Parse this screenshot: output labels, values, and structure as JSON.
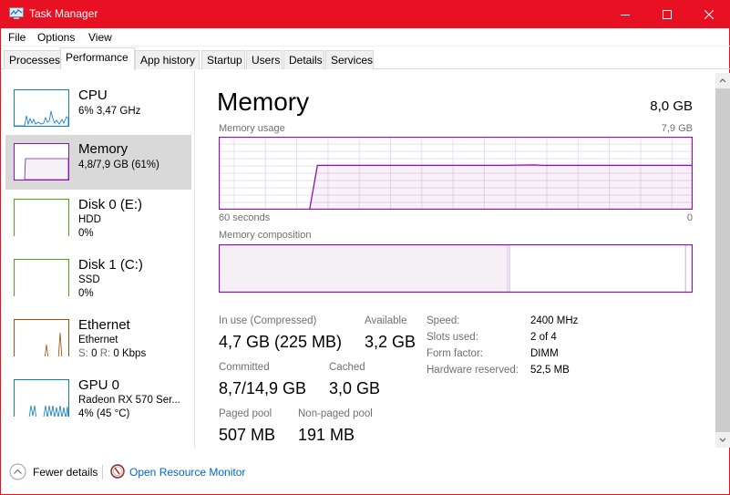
{
  "window": {
    "title": "Task Manager",
    "controls": {
      "minimize": "minimize",
      "maximize": "maximize",
      "close": "close"
    }
  },
  "menu": [
    "File",
    "Options",
    "View"
  ],
  "tabs": [
    {
      "label": "Processes",
      "active": false
    },
    {
      "label": "Performance",
      "active": true
    },
    {
      "label": "App history",
      "active": false
    },
    {
      "label": "Startup",
      "active": false
    },
    {
      "label": "Users",
      "active": false
    },
    {
      "label": "Details",
      "active": false
    },
    {
      "label": "Services",
      "active": false
    }
  ],
  "sidebar": {
    "items": [
      {
        "name": "CPU",
        "line1": "6%  3,47 GHz",
        "line2": "",
        "color": "#117dbb",
        "fill": "#f1f6fa",
        "selected": false
      },
      {
        "name": "Memory",
        "line1": "4,8/7,9 GB (61%)",
        "line2": "",
        "color": "#8b12ae",
        "fill": "#f4f2f4",
        "selected": true
      },
      {
        "name": "Disk 0 (E:)",
        "line1": "HDD",
        "line2": "0%",
        "color": "#4da60c",
        "fill": "#eff7ea",
        "selected": false
      },
      {
        "name": "Disk 1 (C:)",
        "line1": "SSD",
        "line2": "0%",
        "color": "#4da60c",
        "fill": "#eff7ea",
        "selected": false
      },
      {
        "name": "Ethernet",
        "line1": "Ethernet",
        "line2_s_label": "S:",
        "line2_s_val": "0",
        "line2_r_label": "R:",
        "line2_r_val": "0 Kbps",
        "color": "#a74f01",
        "fill": "#fcf3eb",
        "selected": false
      },
      {
        "name": "GPU 0",
        "line1": "Radeon RX 570 Ser...",
        "line2": "4%  (45 °C)",
        "color": "#117dbb",
        "fill": "#f1f6fa",
        "selected": false
      }
    ]
  },
  "main": {
    "title": "Memory",
    "total": "8,0 GB",
    "usage_graph": {
      "label": "Memory usage",
      "max_label": "7,9 GB",
      "left_axis": "60 seconds",
      "right_axis": "0"
    },
    "composition": {
      "label": "Memory composition",
      "in_use_fraction": 0.61,
      "modified_fraction": 0.005,
      "standby_fraction": 0.37,
      "free_fraction": 0.015
    },
    "stats": {
      "in_use_label": "In use (Compressed)",
      "in_use_value": "4,7 GB (225 MB)",
      "available_label": "Available",
      "available_value": "3,2 GB",
      "committed_label": "Committed",
      "committed_value": "8,7/14,9 GB",
      "cached_label": "Cached",
      "cached_value": "3,0 GB",
      "paged_label": "Paged pool",
      "paged_value": "507 MB",
      "nonpaged_label": "Non-paged pool",
      "nonpaged_value": "191 MB"
    },
    "details": [
      {
        "label": "Speed:",
        "value": "2400 MHz"
      },
      {
        "label": "Slots used:",
        "value": "2 of 4"
      },
      {
        "label": "Form factor:",
        "value": "DIMM"
      },
      {
        "label": "Hardware reserved:",
        "value": "52,5 MB"
      }
    ]
  },
  "footer": {
    "fewer_details": "Fewer details",
    "resource_monitor": "Open Resource Monitor"
  },
  "colors": {
    "titlebar": "#e81123",
    "memory_accent": "#8b12ae",
    "link": "#0066cc"
  },
  "chart_data": {
    "type": "area",
    "title": "Memory usage",
    "xlabel": "60 seconds",
    "ylabel": "",
    "xlim": [
      60,
      0
    ],
    "ylim": [
      0,
      7.9
    ],
    "x": [
      60,
      48.5,
      47.5,
      36,
      24,
      20,
      19,
      12,
      0
    ],
    "values": [
      0,
      0,
      4.8,
      4.8,
      4.8,
      4.85,
      4.8,
      4.8,
      4.8
    ],
    "grid": true
  }
}
